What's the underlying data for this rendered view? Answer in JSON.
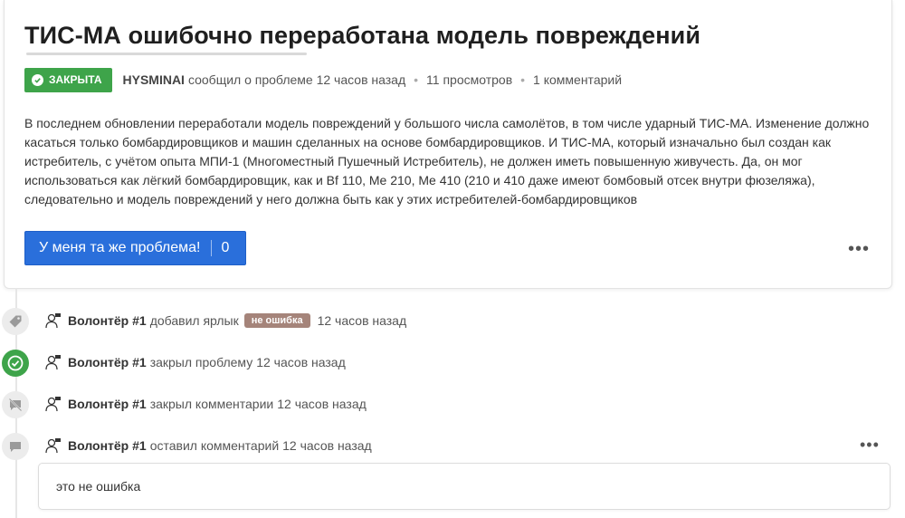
{
  "issue": {
    "title": "ТИС-МА ошибочно переработана модель повреждений",
    "status_badge": "ЗАКРЫТА",
    "author": "HYSMINAI",
    "reported_text": "сообщил о проблеме",
    "reported_time": "12 часов назад",
    "views": "11 просмотров",
    "comments": "1 комментарий",
    "body": "В последнем обновлении переработали модель повреждений у большого числа самолётов, в том числе ударный ТИС-МА. Изменение должно касаться только бомбардировщиков и машин сделанных на основе бомбардировщиков. И ТИС-МА, который изначально был создан как истребитель, с учётом опыта МПИ-1 (Многоместный Пушечный Истребитель), не должен иметь повышенную живучесть. Да, он мог использоваться как лёгкий бомбардировщик, как и Bf 110, Me 210, Me 410 (210 и 410 даже имеют бомбовый отсек внутри фюзеляжа), следовательно и модель повреждений у него должна быть как у этих истребителей-бомбардировщиков",
    "same_problem_label": "У меня та же проблема!",
    "same_problem_count": "0",
    "more_label": "•••"
  },
  "timeline": [
    {
      "icon": "tag-icon",
      "user": "Волонтёр #1",
      "action": "добавил ярлык",
      "label": "не ошибка",
      "time": "12 часов назад"
    },
    {
      "icon": "check-circle-icon",
      "user": "Волонтёр #1",
      "action": "закрыл проблему",
      "time": "12 часов назад"
    },
    {
      "icon": "comments-off-icon",
      "user": "Волонтёр #1",
      "action": "закрыл комментарии",
      "time": "12 часов назад"
    },
    {
      "icon": "comment-icon",
      "user": "Волонтёр #1",
      "action": "оставил комментарий",
      "time": "12 часов назад",
      "more": "•••",
      "comment_text": "это не ошибка"
    }
  ],
  "colors": {
    "accent_blue": "#2a6fdb",
    "closed_green": "#3ea44a",
    "label_brown": "#a5847a"
  }
}
